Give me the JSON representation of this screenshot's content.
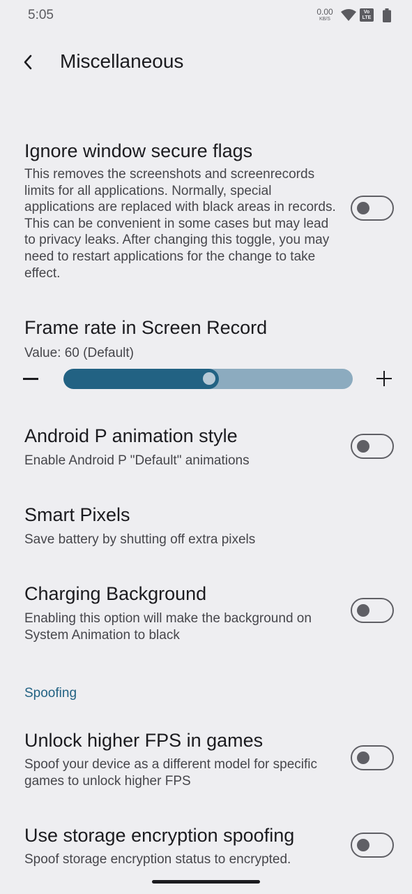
{
  "status_bar": {
    "time": "5:05",
    "net_speed_value": "0.00",
    "net_speed_unit": "KB/S",
    "volte_top": "Vo",
    "volte_bottom": "LTE",
    "icons": [
      "wifi-icon",
      "volte-icon",
      "battery-icon"
    ]
  },
  "app_bar": {
    "back_icon": "chevron-left-icon",
    "title": "Miscellaneous"
  },
  "prefs": {
    "ignore_secure": {
      "title": "Ignore window secure flags",
      "summary": "This removes the screenshots and screenrecords limits for all applications. Normally, special applications are replaced with black areas in records. This can be convenient in some cases but may lead to privacy leaks. After changing this toggle, you may need to restart applications for the change to take effect.",
      "enabled": false
    },
    "frame_rate": {
      "title": "Frame rate in Screen Record",
      "summary": "Value: 60 (Default)",
      "slider_fraction": 0.5
    },
    "android_p": {
      "title": "Android P animation style",
      "summary": "Enable Android P \"Default\" animations",
      "enabled": false
    },
    "smart_pixels": {
      "title": "Smart Pixels",
      "summary": "Save battery by shutting off extra pixels"
    },
    "charging_bg": {
      "title": "Charging Background",
      "summary": "Enabling this option will make the background on System Animation to black",
      "enabled": false
    },
    "spoofing_header": "Spoofing",
    "higher_fps": {
      "title": "Unlock higher FPS in games",
      "summary": "Spoof your device as a different model for specific games to unlock higher FPS",
      "enabled": false
    },
    "storage_spoof": {
      "title": "Use storage encryption spoofing",
      "summary": "Spoof storage encryption status to encrypted.",
      "enabled": false
    }
  },
  "colors": {
    "background": "#eeeef1",
    "accent": "#226283",
    "slider_inactive": "#8cabbf",
    "switch_outline": "#5f5f65"
  }
}
